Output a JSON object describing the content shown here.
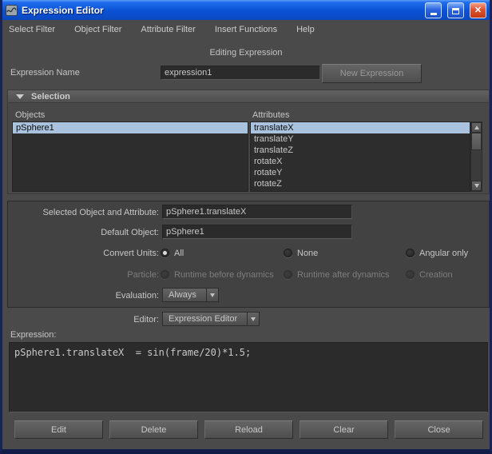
{
  "window": {
    "title": "Expression Editor"
  },
  "menubar": {
    "items": [
      "Select Filter",
      "Object Filter",
      "Attribute Filter",
      "Insert Functions",
      "Help"
    ]
  },
  "heading": "Editing Expression",
  "expression_name": {
    "label": "Expression Name",
    "value": "expression1",
    "new_button": "New Expression"
  },
  "selection": {
    "header": "Selection",
    "objects_label": "Objects",
    "attributes_label": "Attributes",
    "objects": [
      "pSphere1"
    ],
    "attributes": [
      "translateX",
      "translateY",
      "translateZ",
      "rotateX",
      "rotateY",
      "rotateZ"
    ],
    "selected_object": "pSphere1",
    "selected_attribute": "translateX"
  },
  "form": {
    "selected_object_attribute": {
      "label": "Selected Object and Attribute:",
      "value": "pSphere1.translateX"
    },
    "default_object": {
      "label": "Default Object:",
      "value": "pSphere1"
    },
    "convert_units": {
      "label": "Convert Units:",
      "options": [
        "All",
        "None",
        "Angular only"
      ],
      "selected": "All"
    },
    "particle": {
      "label": "Particle:",
      "options": [
        "Runtime before dynamics",
        "Runtime after dynamics",
        "Creation"
      ],
      "disabled": true
    },
    "evaluation": {
      "label": "Evaluation:",
      "value": "Always"
    },
    "editor": {
      "label": "Editor:",
      "value": "Expression Editor"
    }
  },
  "expression": {
    "label": "Expression:",
    "code": "pSphere1.translateX  = sin(frame/20)*1.5;"
  },
  "footer_buttons": [
    "Edit",
    "Delete",
    "Reload",
    "Clear",
    "Close"
  ],
  "colors": {
    "titlebar_blue": "#0a51d4",
    "window_bg": "#4a4a4a",
    "field_bg": "#2b2b2b",
    "selection_highlight": "#a9c3de",
    "close_red": "#c03a14"
  }
}
